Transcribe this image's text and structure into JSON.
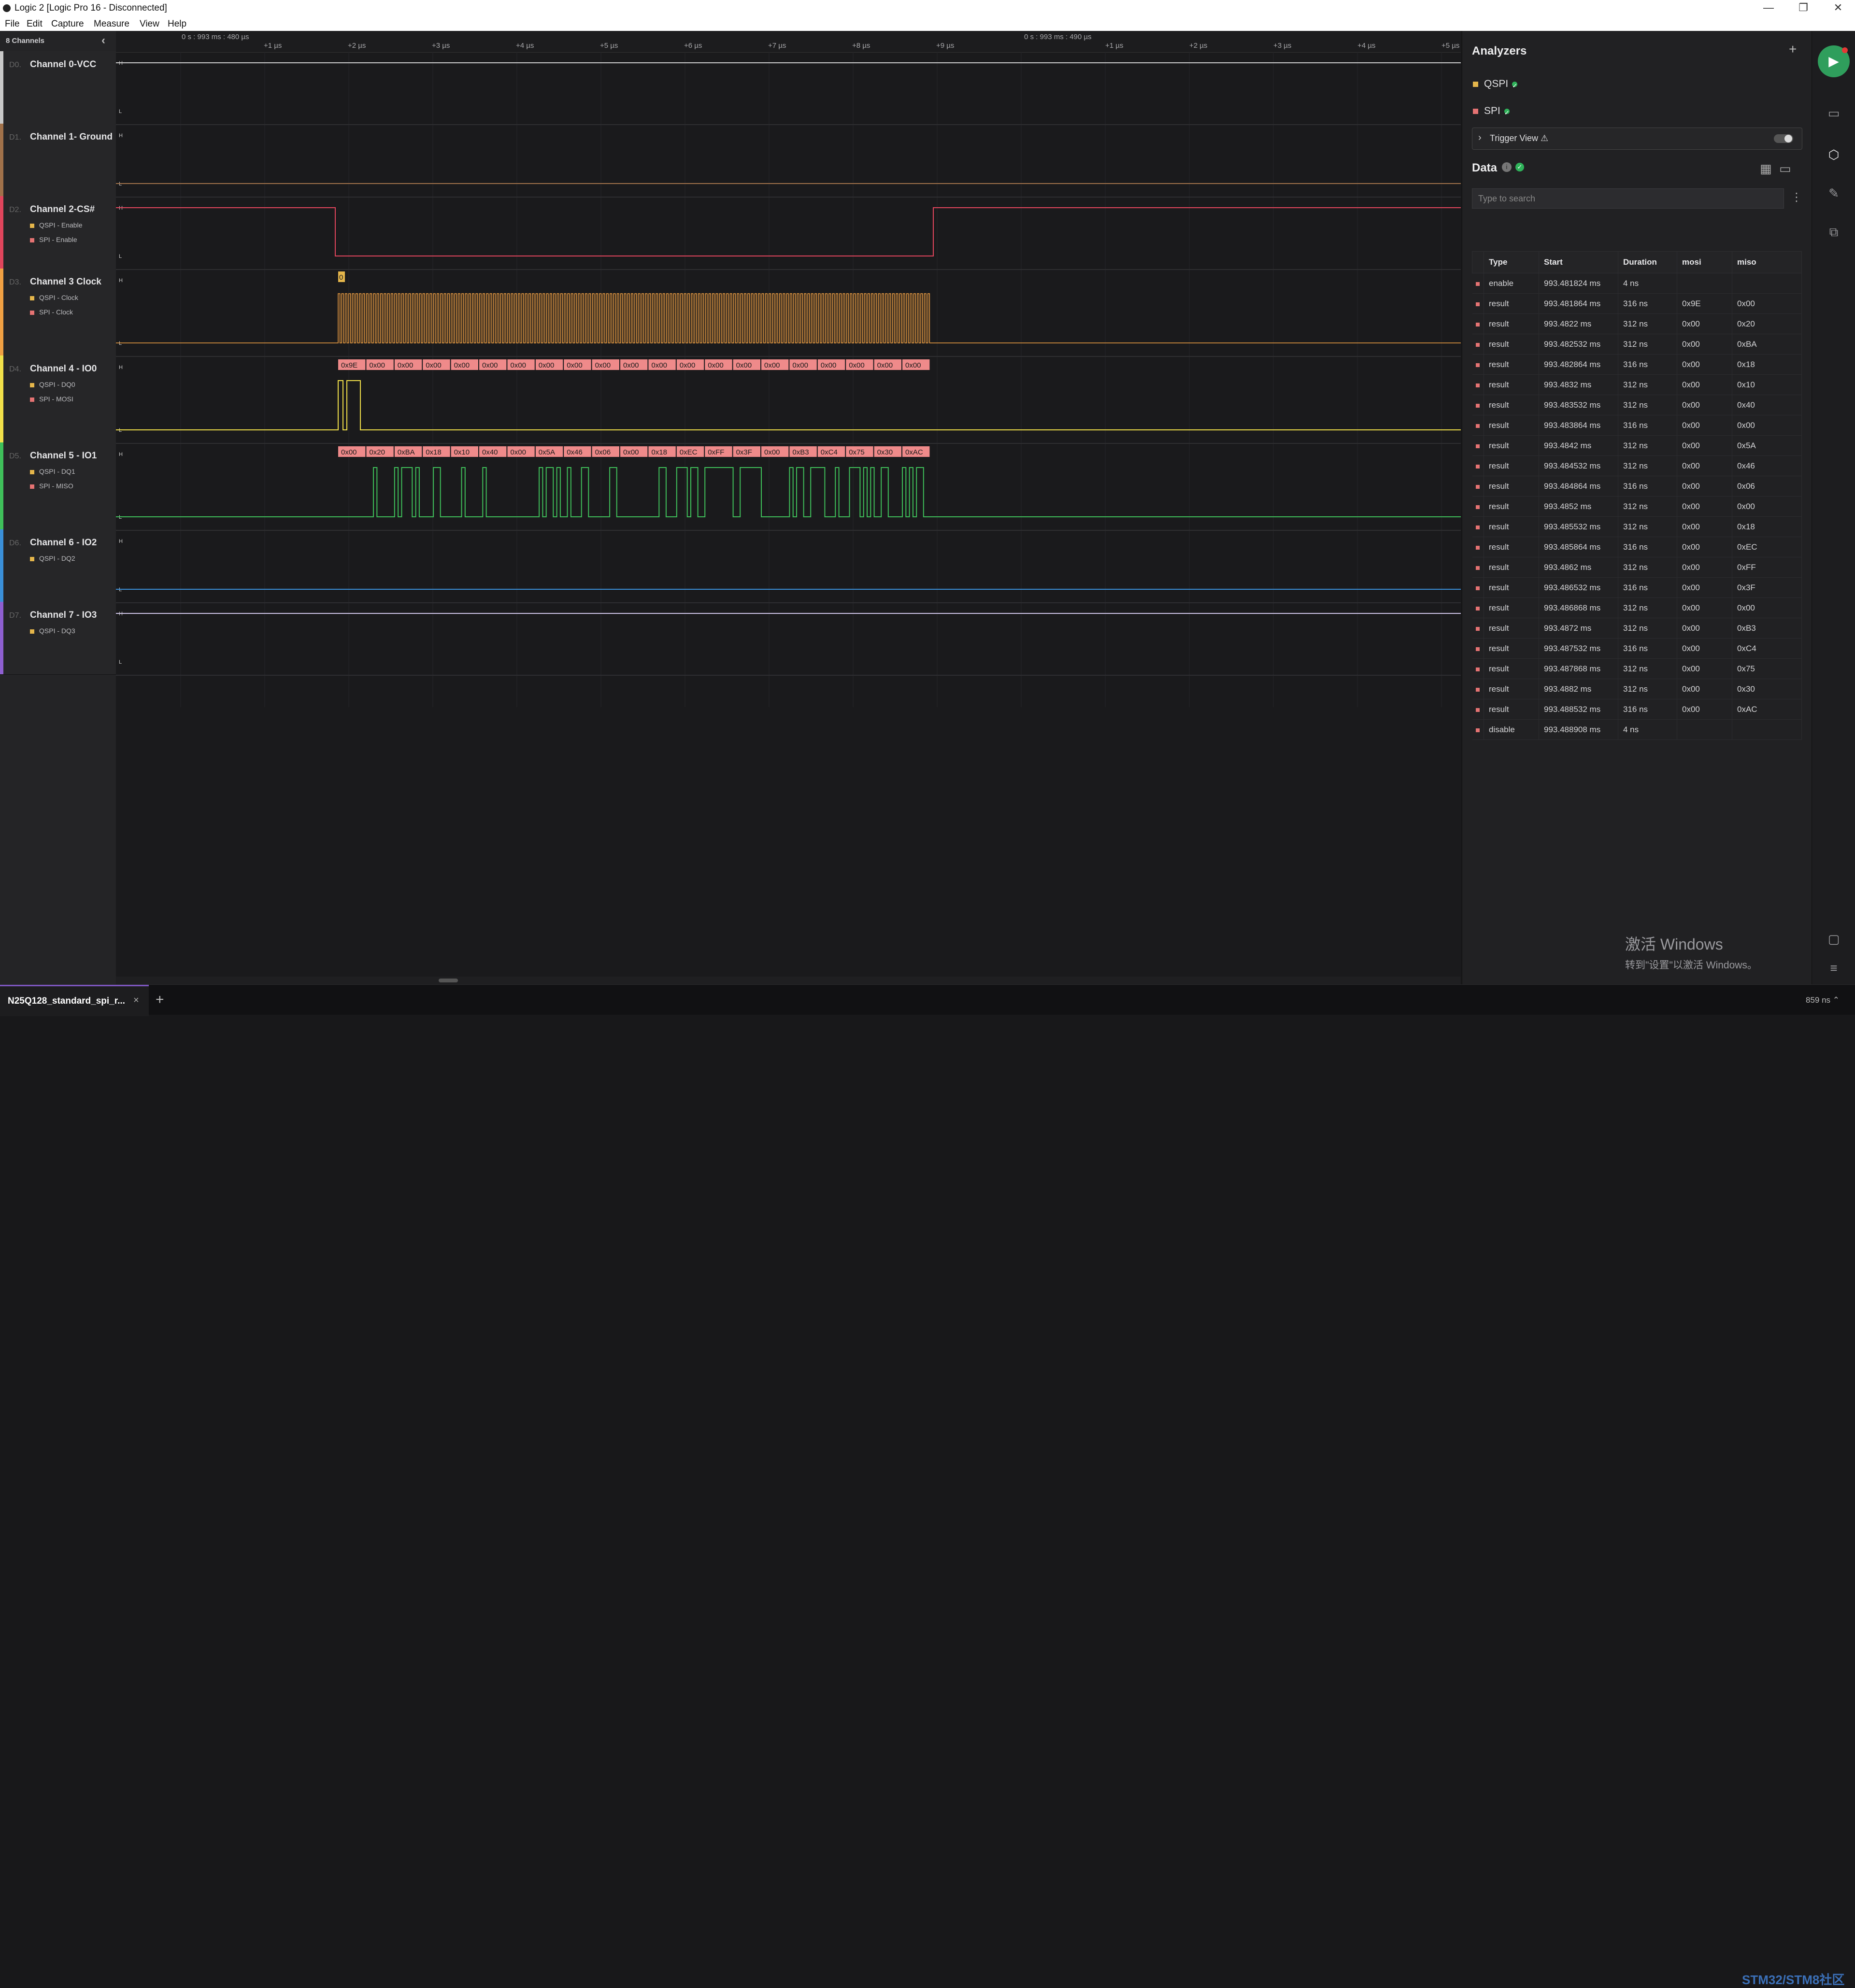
{
  "window": {
    "title": "Logic 2 [Logic Pro 16 - Disconnected]",
    "controls": {
      "minimize": "—",
      "restore": "❐",
      "close": "✕"
    }
  },
  "menu": [
    "File",
    "Edit",
    "Capture",
    "Measure",
    "View",
    "Help"
  ],
  "sidebar": {
    "header": "8 Channels",
    "collapse_icon": "‹",
    "channels": [
      {
        "num": "D0.",
        "name": "Channel 0-VCC",
        "color": "#c8c8c8",
        "subs": []
      },
      {
        "num": "D1.",
        "name": "Channel 1- Ground",
        "color": "#a0714a",
        "subs": []
      },
      {
        "num": "D2.",
        "name": "Channel 2-CS#",
        "color": "#e0455c",
        "subs": [
          {
            "label": "QSPI - Enable",
            "color": "#e5b64b"
          },
          {
            "label": "SPI - Enable",
            "color": "#e57373"
          }
        ]
      },
      {
        "num": "D3.",
        "name": "Channel 3 Clock",
        "color": "#f0a043",
        "subs": [
          {
            "label": "QSPI - Clock",
            "color": "#e5b64b"
          },
          {
            "label": "SPI - Clock",
            "color": "#e57373"
          }
        ]
      },
      {
        "num": "D4.",
        "name": "Channel 4 - IO0",
        "color": "#f1e04a",
        "subs": [
          {
            "label": "QSPI - DQ0",
            "color": "#e5b64b"
          },
          {
            "label": "SPI - MOSI",
            "color": "#e57373"
          }
        ]
      },
      {
        "num": "D5.",
        "name": "Channel 5 - IO1",
        "color": "#3fbf5a",
        "subs": [
          {
            "label": "QSPI - DQ1",
            "color": "#e5b64b"
          },
          {
            "label": "SPI - MISO",
            "color": "#e57373"
          }
        ]
      },
      {
        "num": "D6.",
        "name": "Channel 6 - IO2",
        "color": "#3a8fd8",
        "subs": [
          {
            "label": "QSPI - DQ2",
            "color": "#e5b64b"
          }
        ]
      },
      {
        "num": "D7.",
        "name": "Channel 7 - IO3",
        "color": "#8e5fd0",
        "subs": [
          {
            "label": "QSPI - DQ3",
            "color": "#e5b64b"
          }
        ]
      }
    ]
  },
  "ruler": {
    "marks": [
      "0 s : 993 ms : 480 µs",
      "0 s : 993 ms : 490 µs"
    ],
    "ticks": [
      "+1 µs",
      "+2 µs",
      "+3 µs",
      "+4 µs",
      "+5 µs",
      "+6 µs",
      "+7 µs",
      "+8 µs",
      "+9 µs",
      "+1 µs",
      "+2 µs",
      "+3 µs",
      "+4 µs",
      "+5 µs"
    ]
  },
  "waveform": {
    "level_high": "H",
    "level_low": "L",
    "clock_marker": "0",
    "mosi_bytes": [
      "0x9E",
      "0x00",
      "0x00",
      "0x00",
      "0x00",
      "0x00",
      "0x00",
      "0x00",
      "0x00",
      "0x00",
      "0x00",
      "0x00",
      "0x00",
      "0x00",
      "0x00",
      "0x00",
      "0x00",
      "0x00",
      "0x00",
      "0x00",
      "0x00"
    ],
    "miso_bytes": [
      "0x00",
      "0x20",
      "0xBA",
      "0x18",
      "0x10",
      "0x40",
      "0x00",
      "0x5A",
      "0x46",
      "0x06",
      "0x00",
      "0x18",
      "0xEC",
      "0xFF",
      "0x3F",
      "0x00",
      "0xB3",
      "0xC4",
      "0x75",
      "0x30",
      "0xAC"
    ]
  },
  "analyzers": {
    "title": "Analyzers",
    "add_icon": "+",
    "items": [
      {
        "name": "QSPI",
        "color": "#e5b64b"
      },
      {
        "name": "SPI",
        "color": "#e57373"
      }
    ],
    "trigger_view": "Trigger View ⚠"
  },
  "data": {
    "title": "Data",
    "search_placeholder": "Type to search",
    "columns": [
      "Type",
      "Start",
      "Duration",
      "mosi",
      "miso"
    ],
    "rows": [
      [
        "enable",
        "993.481824 ms",
        "4 ns",
        "",
        ""
      ],
      [
        "result",
        "993.481864 ms",
        "316 ns",
        "0x9E",
        "0x00"
      ],
      [
        "result",
        "993.4822 ms",
        "312 ns",
        "0x00",
        "0x20"
      ],
      [
        "result",
        "993.482532 ms",
        "312 ns",
        "0x00",
        "0xBA"
      ],
      [
        "result",
        "993.482864 ms",
        "316 ns",
        "0x00",
        "0x18"
      ],
      [
        "result",
        "993.4832 ms",
        "312 ns",
        "0x00",
        "0x10"
      ],
      [
        "result",
        "993.483532 ms",
        "312 ns",
        "0x00",
        "0x40"
      ],
      [
        "result",
        "993.483864 ms",
        "316 ns",
        "0x00",
        "0x00"
      ],
      [
        "result",
        "993.4842 ms",
        "312 ns",
        "0x00",
        "0x5A"
      ],
      [
        "result",
        "993.484532 ms",
        "312 ns",
        "0x00",
        "0x46"
      ],
      [
        "result",
        "993.484864 ms",
        "316 ns",
        "0x00",
        "0x06"
      ],
      [
        "result",
        "993.4852 ms",
        "312 ns",
        "0x00",
        "0x00"
      ],
      [
        "result",
        "993.485532 ms",
        "312 ns",
        "0x00",
        "0x18"
      ],
      [
        "result",
        "993.485864 ms",
        "316 ns",
        "0x00",
        "0xEC"
      ],
      [
        "result",
        "993.4862 ms",
        "312 ns",
        "0x00",
        "0xFF"
      ],
      [
        "result",
        "993.486532 ms",
        "316 ns",
        "0x00",
        "0x3F"
      ],
      [
        "result",
        "993.486868 ms",
        "312 ns",
        "0x00",
        "0x00"
      ],
      [
        "result",
        "993.4872 ms",
        "312 ns",
        "0x00",
        "0xB3"
      ],
      [
        "result",
        "993.487532 ms",
        "316 ns",
        "0x00",
        "0xC4"
      ],
      [
        "result",
        "993.487868 ms",
        "312 ns",
        "0x00",
        "0x75"
      ],
      [
        "result",
        "993.4882 ms",
        "312 ns",
        "0x00",
        "0x30"
      ],
      [
        "result",
        "993.488532 ms",
        "316 ns",
        "0x00",
        "0xAC"
      ],
      [
        "disable",
        "993.488908 ms",
        "4 ns",
        "",
        ""
      ]
    ]
  },
  "tabs": [
    {
      "label": "N25Q128_standard_spi_r...",
      "close": "×"
    }
  ],
  "tab_add": "+",
  "status": "859 ns ⌃",
  "watermark": {
    "line1": "激活 Windows",
    "line2": "转到\"设置\"以激活 Windows。"
  },
  "sitemark": "STM32/STM8社区",
  "icons": [
    "play-icon",
    "keyboard-icon",
    "analyzer-icon",
    "marker-icon",
    "extension-icon",
    "chat-icon",
    "menu-icon"
  ],
  "colors": {
    "accent": "#7e57c2",
    "run": "#2f9e5c",
    "spi": "#e57373",
    "qspi": "#e5b64b"
  }
}
